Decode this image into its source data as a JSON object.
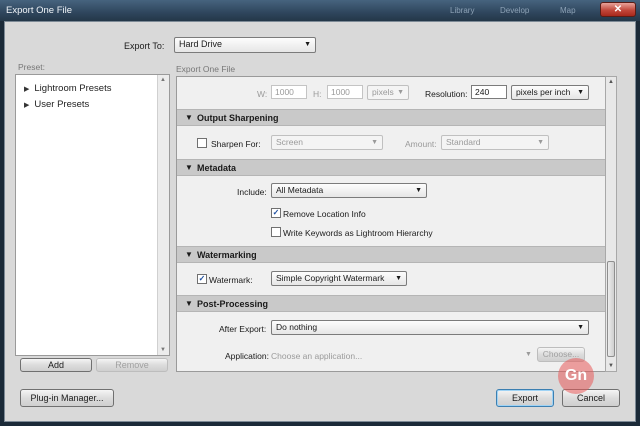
{
  "window": {
    "title": "Export One File",
    "background_tabs": [
      "Library",
      "Develop",
      "Map"
    ],
    "close_glyph": "✕"
  },
  "export_to": {
    "label": "Export To:",
    "value": "Hard Drive"
  },
  "preset": {
    "label": "Preset:",
    "items": [
      "Lightroom Presets",
      "User Presets"
    ],
    "add_label": "Add",
    "remove_label": "Remove"
  },
  "main": {
    "header_label": "Export One File",
    "size": {
      "w_label": "W:",
      "w_value": "1000",
      "h_label": "H:",
      "h_value": "1000",
      "unit": "pixels",
      "resolution_label": "Resolution:",
      "resolution_value": "240",
      "resolution_unit": "pixels per inch"
    },
    "output_sharpening": {
      "title": "Output Sharpening",
      "sharpen_label": "Sharpen For:",
      "sharpen_value": "Screen",
      "amount_label": "Amount:",
      "amount_value": "Standard"
    },
    "metadata": {
      "title": "Metadata",
      "include_label": "Include:",
      "include_value": "All Metadata",
      "remove_location_label": "Remove Location Info",
      "write_keywords_label": "Write Keywords as Lightroom Hierarchy"
    },
    "watermarking": {
      "title": "Watermarking",
      "watermark_label": "Watermark:",
      "watermark_value": "Simple Copyright Watermark"
    },
    "post_processing": {
      "title": "Post-Processing",
      "after_export_label": "After Export:",
      "after_export_value": "Do nothing",
      "application_label": "Application:",
      "application_placeholder": "Choose an application...",
      "choose_button": "Choose..."
    }
  },
  "footer": {
    "plugin_manager": "Plug-in Manager...",
    "export": "Export",
    "cancel": "Cancel"
  },
  "logo_text": "Gn",
  "glyphs": {
    "dropdown": "▼",
    "collapse": "▼",
    "expand": "▶",
    "check": "✓",
    "scroll_up": "▲",
    "scroll_down": "▼"
  },
  "colors": {
    "title_bar": "#2f465d",
    "dialog_bg": "#d9d9d9",
    "close_button": "#c2483b",
    "default_button": "#3c7fb1"
  }
}
